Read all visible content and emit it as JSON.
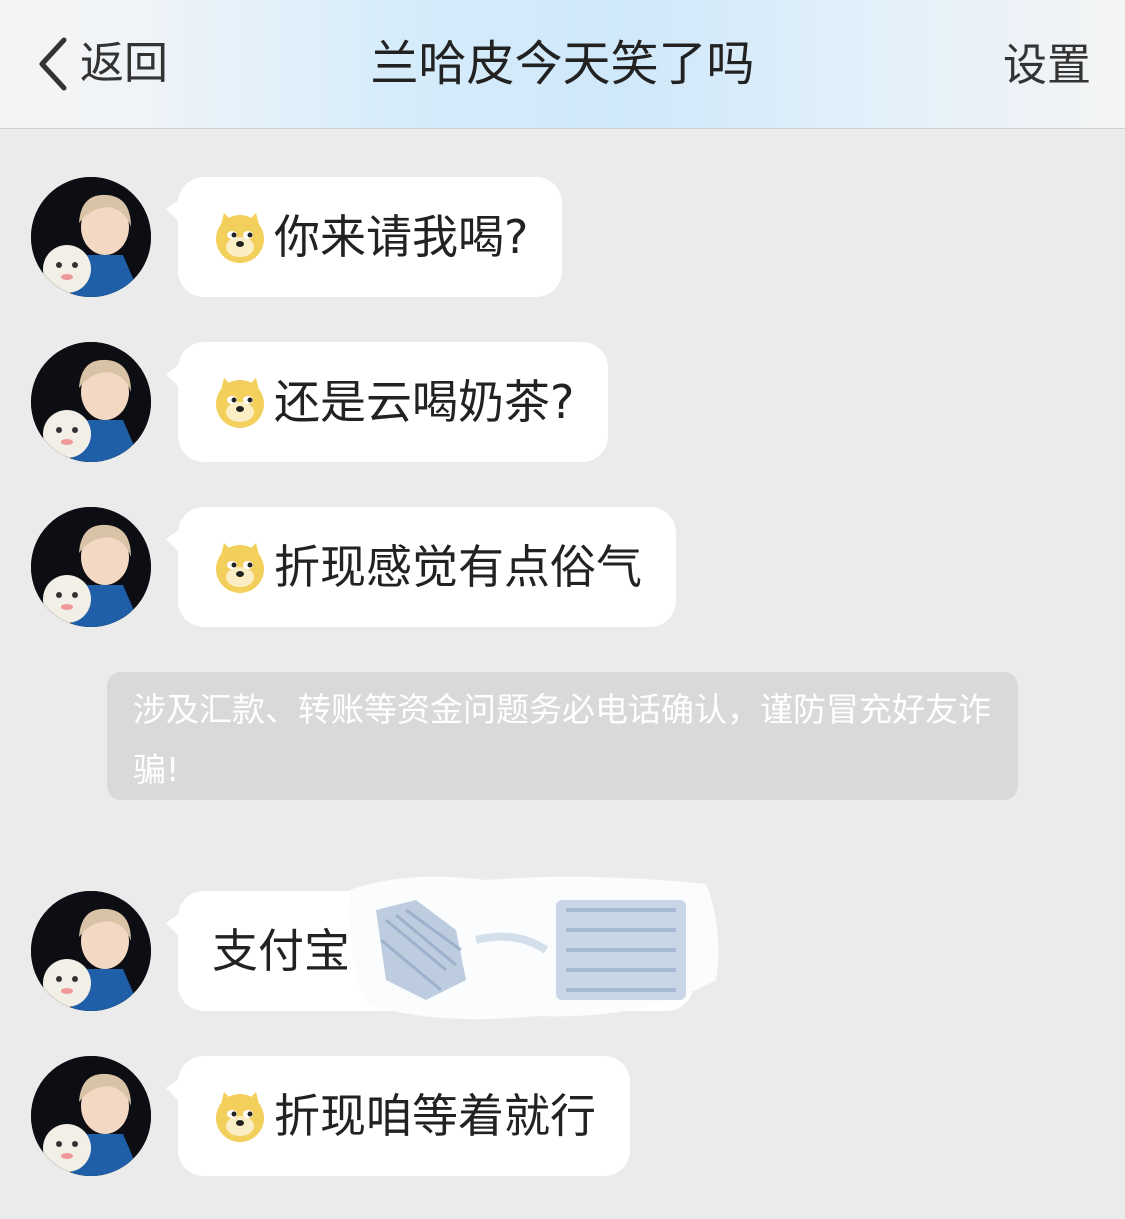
{
  "navbar": {
    "back_label": "返回",
    "title": "兰哈皮今天笑了吗",
    "settings_label": "设置"
  },
  "messages": [
    {
      "text": "你来请我喝?",
      "emoji": "doge-emoji"
    },
    {
      "text": "还是云喝奶茶?",
      "emoji": "doge-emoji"
    },
    {
      "text": "折现感觉有点俗气",
      "emoji": "doge-emoji"
    },
    {
      "text": "支付宝1",
      "emoji": null,
      "redacted": true
    },
    {
      "text": "折现咱等着就行",
      "emoji": "doge-emoji"
    }
  ],
  "system_notice": {
    "text": "涉及汇款、转账等资金问题务必电话确认，谨防冒充好友诈骗!"
  },
  "colors": {
    "background": "#ebebeb",
    "bubble": "#ffffff",
    "notice_bg": "#d9d9d9",
    "navbar_accent": "#cfe8fa"
  }
}
